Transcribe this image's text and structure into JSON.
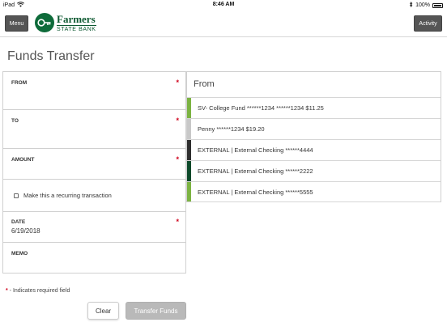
{
  "status_bar": {
    "device": "iPad",
    "time": "8:46 AM",
    "battery": "100%"
  },
  "header": {
    "menu_label": "Menu",
    "activity_label": "Activity",
    "logo_top": "Farmers",
    "logo_bottom": "STATE BANK",
    "logo_color": "#0e6b3a"
  },
  "page": {
    "title": "Funds Transfer"
  },
  "form": {
    "from_label": "FROM",
    "to_label": "TO",
    "amount_label": "AMOUNT",
    "recurring_label": "Make this a recurring transaction",
    "date_label": "DATE",
    "date_value": "6/19/2018",
    "memo_label": "MEMO",
    "required_marker": "*",
    "required_note": " - Indicates required field",
    "required_color": "#d0021b"
  },
  "actions": {
    "clear_label": "Clear",
    "transfer_label": "Transfer Funds"
  },
  "panel": {
    "title": "From",
    "accounts": [
      {
        "label": "SV- College Fund ******1234 ******1234 $11.25",
        "color": "#7cb342"
      },
      {
        "label": "Penny ******1234 $19.20",
        "color": "#c8c8c8"
      },
      {
        "label": "EXTERNAL | External Checking ******4444",
        "color": "#2e2e2e"
      },
      {
        "label": "EXTERNAL | External Checking ******2222",
        "color": "#0d4a2a"
      },
      {
        "label": "EXTERNAL | External Checking ******5555",
        "color": "#7cb342"
      }
    ]
  }
}
